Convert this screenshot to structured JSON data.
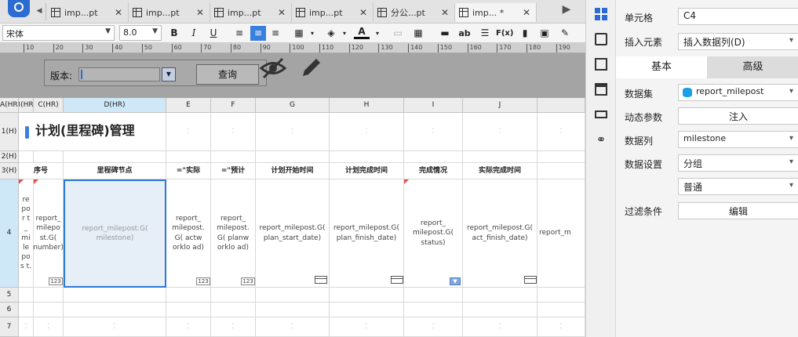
{
  "tabs": [
    {
      "label": "imp...pt",
      "active": false
    },
    {
      "label": "imp...pt",
      "active": false
    },
    {
      "label": "imp...pt",
      "active": false
    },
    {
      "label": "imp...pt",
      "active": false
    },
    {
      "label": "分公...pt",
      "active": false
    },
    {
      "label": "imp... *",
      "active": true
    }
  ],
  "toolbar": {
    "font_name": "宋体",
    "font_size": "8.0",
    "bold": "B",
    "italic": "I",
    "underline": "U",
    "ab": "ab",
    "fx": "F(x)"
  },
  "ruler": [
    "10",
    "20",
    "30",
    "40",
    "50",
    "60",
    "70",
    "80",
    "90",
    "100",
    "110",
    "120",
    "130",
    "140",
    "150",
    "160",
    "170",
    "180",
    "190"
  ],
  "param": {
    "version_label": "版本:",
    "query_button": "查询"
  },
  "columns": [
    "A(HR)",
    "B(HR)",
    "C(HR)",
    "D(HR)",
    "E",
    "F",
    "G",
    "H",
    "I",
    "J",
    ""
  ],
  "rows": [
    "1(H)",
    "2(H)",
    "3(H)",
    "4",
    "5",
    "6",
    "7"
  ],
  "title": "计划(里程碑)管理",
  "header_row": [
    "序号",
    "里程碑节点",
    "=\"实际",
    "=\"预计",
    "计划开始时间",
    "计划完成时间",
    "完成情况",
    "实际完成时间"
  ],
  "cells": {
    "a4": "repor t_ mi le pos t.",
    "b4": "report_ milepo st.G( number)",
    "d4": "report_milepost.G( milestone)",
    "e4": "report_ milepost. G( actw orklo ad)",
    "f4": "report_ milepost. G( planw orklo ad)",
    "g4": "report_milepost.G( plan_start_date)",
    "h4": "report_milepost.G( plan_finish_date)",
    "i4": "report_ milepost.G( status)",
    "j4": "report_milepost.G( act_finish_date)",
    "k4": "report_m",
    "num_badge": "123"
  },
  "panel": {
    "cell_label": "单元格",
    "cell_value": "C4",
    "insert_label": "插入元素",
    "insert_value": "插入数据列(D)",
    "tab_basic": "基本",
    "tab_advanced": "高级",
    "dataset_label": "数据集",
    "dataset_value": "report_milepost",
    "dyn_param_label": "动态参数",
    "inject_button": "注入",
    "column_label": "数据列",
    "column_value": "milestone",
    "setting_label": "数据设置",
    "setting_value": "分组",
    "setting_value2": "普通",
    "filter_label": "过滤条件",
    "edit_button": "编辑"
  },
  "colors": {
    "accent": "#3a7fe0",
    "selection": "#2b79d8",
    "param_bg": "#a4a4a4",
    "dataset_icon": "#1aa0e8"
  }
}
